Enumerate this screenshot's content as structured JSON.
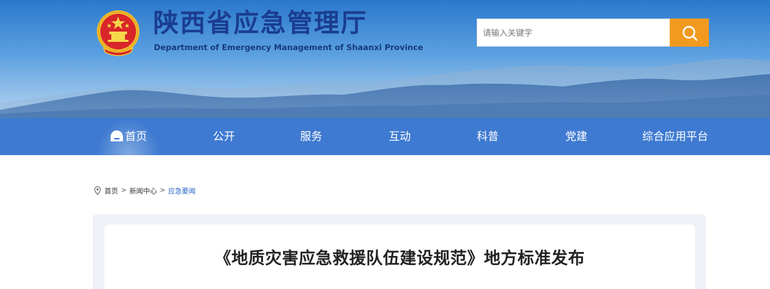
{
  "header": {
    "title": "陕西省应急管理厅",
    "subtitle": "Department of Emergency Management of Shaanxi Province",
    "emblem_icon": "national-emblem-icon"
  },
  "search": {
    "placeholder": "请输入关键字",
    "button_icon": "search-icon"
  },
  "nav": {
    "items": [
      {
        "label": "首页",
        "active": true,
        "icon": "home-icon"
      },
      {
        "label": "公开"
      },
      {
        "label": "服务"
      },
      {
        "label": "互动"
      },
      {
        "label": "科普"
      },
      {
        "label": "党建"
      },
      {
        "label": "综合应用平台"
      }
    ]
  },
  "breadcrumb": {
    "icon": "location-pin-icon",
    "items": [
      "首页",
      "新闻中心",
      "应急要闻"
    ],
    "separator": ">"
  },
  "article": {
    "title": "《地质灾害应急救援队伍建设规范》地方标准发布"
  },
  "colors": {
    "nav_bg": "#3e7ad1",
    "search_button": "#f29a1f",
    "title_blue": "#1a3d8f",
    "breadcrumb_current": "#2a66c4"
  }
}
